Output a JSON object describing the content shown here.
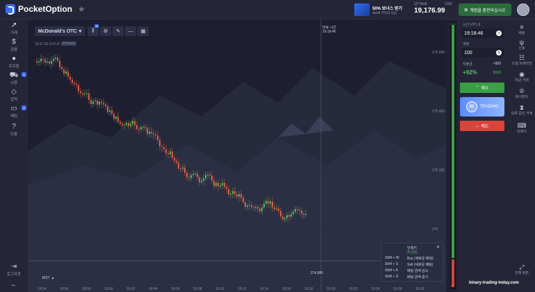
{
  "brand": {
    "name": "PocketOption"
  },
  "header": {
    "bonus_title": "50% 보너스 받기",
    "bonus_sub": "$50로 부터의 입금",
    "account_type": "QT Real",
    "currency": "USD",
    "balance": "19,176.99",
    "deposit_label": "계정을 충전하십시오"
  },
  "sidebar": {
    "items": [
      {
        "label": "거래",
        "icon": "chart-icon"
      },
      {
        "label": "금융",
        "icon": "dollar-icon"
      },
      {
        "label": "프로필",
        "icon": "user-icon"
      },
      {
        "label": "시장",
        "icon": "cart-icon"
      },
      {
        "label": "업적",
        "icon": "diamond-icon"
      },
      {
        "label": "채팅",
        "icon": "chat-icon"
      },
      {
        "label": "도움",
        "icon": "help-icon"
      }
    ],
    "logout": "로그아웃"
  },
  "chart": {
    "asset": "McDonald's OTC",
    "timestamp": "19:17:30 UTC-3",
    "tag_label": "274.623",
    "expiry_label": "만료 시간",
    "expiry_time": "19:18:46",
    "current_price": "274.885",
    "timeframe": "M37",
    "badge_count": "15",
    "y_labels": [
      "275.600",
      "275.400",
      "275.200",
      "275"
    ],
    "x_labels": [
      "18:54",
      "18:56",
      "18:58",
      "19:00",
      "19:02",
      "19:04",
      "19:06",
      "19:08",
      "19:10",
      "19:12",
      "19:14",
      "19:16",
      "19:18",
      "19:20",
      "19:22",
      "19:24",
      "19:26",
      "19:28"
    ]
  },
  "hotkeys": {
    "title": "단축키",
    "subtitle": "[토글됨]",
    "rows": [
      {
        "key": "Shift + W",
        "desc": "Buy (새로운 베팅)"
      },
      {
        "key": "Shift + S",
        "desc": "Sell (새로운 베팅)"
      },
      {
        "key": "Shift + A",
        "desc": "베팅 금액 감소"
      },
      {
        "key": "Shift + D",
        "desc": "베팅 금액 증가"
      }
    ]
  },
  "panel": {
    "time_label": "시간 UTC-3",
    "time_value": "19:18:46",
    "amount_label": "계정",
    "amount_value": "100",
    "payout_label": "지불금",
    "payout_plus": "+$92",
    "payout_pct": "+92%",
    "payout_total": "$192",
    "buy_label": "매수",
    "ai_badge": "AI",
    "ai_label": "TRADING",
    "sell_label": "매도",
    "bar_top": "91%",
    "bar_bottom": "9%"
  },
  "right_sidebar": {
    "items": [
      {
        "label": "베팅",
        "icon": "stack-icon"
      },
      {
        "label": "신호",
        "icon": "signal-icon"
      },
      {
        "label": "소셜 트레이딩",
        "icon": "social-icon"
      },
      {
        "label": "직급 거래",
        "icon": "rank-icon"
      },
      {
        "label": "토너먼트",
        "icon": "trophy-icon"
      },
      {
        "label": "보류 중인 거래",
        "icon": "pending-icon"
      },
      {
        "label": "단축키",
        "icon": "keyboard-icon"
      }
    ],
    "fullscreen": "전체 화면"
  },
  "watermark": "binary-trading-today.com"
}
